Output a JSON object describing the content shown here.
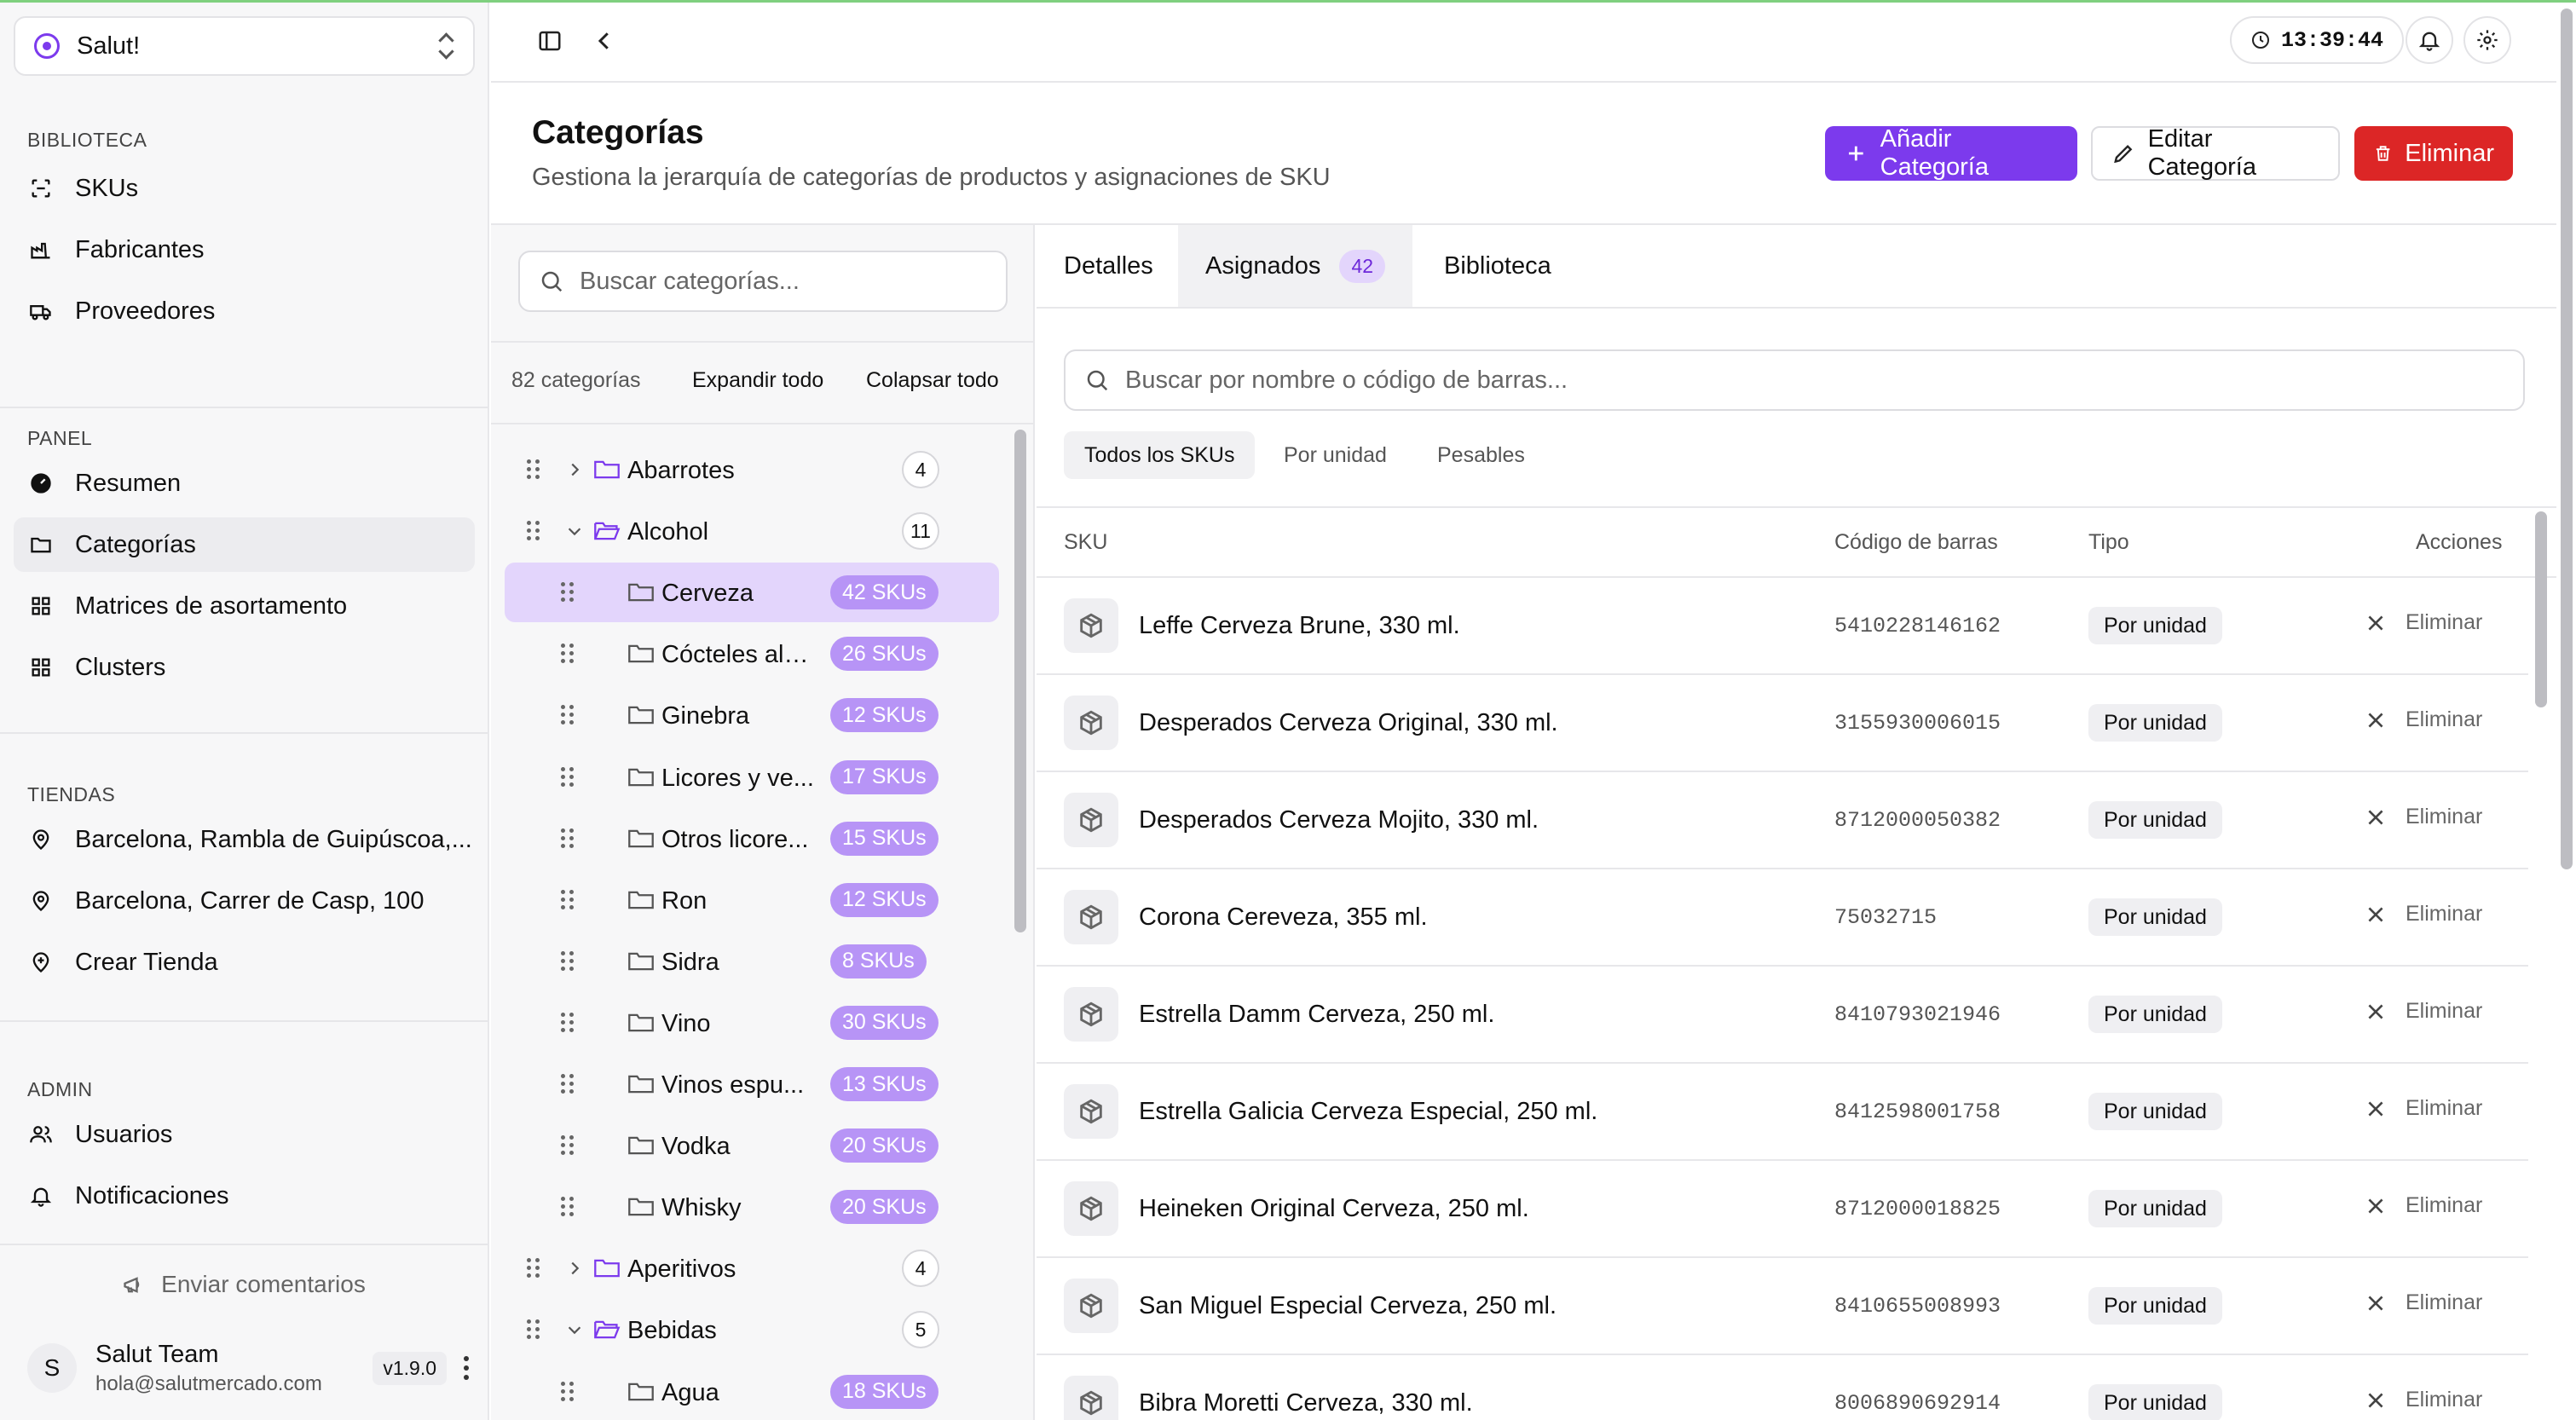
{
  "workspace": {
    "name": "Salut!"
  },
  "sidebar": {
    "sections": [
      {
        "label": "BIBLIOTECA",
        "items": [
          {
            "label": "SKUs",
            "icon": "scan-icon"
          },
          {
            "label": "Fabricantes",
            "icon": "factory-icon"
          },
          {
            "label": "Proveedores",
            "icon": "truck-icon"
          }
        ]
      },
      {
        "label": "PANEL",
        "items": [
          {
            "label": "Resumen",
            "icon": "gauge-icon"
          },
          {
            "label": "Categorías",
            "icon": "folder-icon",
            "active": true
          },
          {
            "label": "Matrices de asortamento",
            "icon": "grid-icon"
          },
          {
            "label": "Clusters",
            "icon": "grid-icon"
          }
        ]
      },
      {
        "label": "TIENDAS",
        "items": [
          {
            "label": "Barcelona, Rambla de Guipúscoa,...",
            "icon": "map-pin-icon"
          },
          {
            "label": "Barcelona, Carrer de Casp, 100",
            "icon": "map-pin-icon"
          },
          {
            "label": "Crear Tienda",
            "icon": "map-pin-plus-icon"
          }
        ]
      },
      {
        "label": "ADMIN",
        "items": [
          {
            "label": "Usuarios",
            "icon": "users-icon"
          },
          {
            "label": "Notificaciones",
            "icon": "bell-icon"
          }
        ]
      }
    ],
    "feedback": "Enviar comentarios",
    "user": {
      "initial": "S",
      "name": "Salut Team",
      "email": "hola@salutmercado.com",
      "version": "v1.9.0"
    }
  },
  "topbar": {
    "clock": "13:39:44"
  },
  "header": {
    "title": "Categorías",
    "subtitle": "Gestiona la jerarquía de categorías de productos y asignaciones de SKU",
    "add_label": "Añadir Categoría",
    "edit_label": "Editar Categoría",
    "delete_label": "Eliminar"
  },
  "categories": {
    "search_placeholder": "Buscar categorías...",
    "count_label": "82 categorías",
    "expand_all": "Expandir todo",
    "collapse_all": "Colapsar todo",
    "tree": [
      {
        "label": "Abarrotes",
        "level": 0,
        "expanded": false,
        "count": "4"
      },
      {
        "label": "Alcohol",
        "level": 0,
        "expanded": true,
        "count": "11"
      },
      {
        "label": "Cerveza",
        "level": 1,
        "count": "42 SKUs",
        "selected": true
      },
      {
        "label": "Cócteles alc...",
        "level": 1,
        "count": "26 SKUs"
      },
      {
        "label": "Ginebra",
        "level": 1,
        "count": "12 SKUs"
      },
      {
        "label": "Licores y ve...",
        "level": 1,
        "count": "17 SKUs"
      },
      {
        "label": "Otros licore...",
        "level": 1,
        "count": "15 SKUs"
      },
      {
        "label": "Ron",
        "level": 1,
        "count": "12 SKUs"
      },
      {
        "label": "Sidra",
        "level": 1,
        "count": "8 SKUs"
      },
      {
        "label": "Vino",
        "level": 1,
        "count": "30 SKUs"
      },
      {
        "label": "Vinos espu...",
        "level": 1,
        "count": "13 SKUs"
      },
      {
        "label": "Vodka",
        "level": 1,
        "count": "20 SKUs"
      },
      {
        "label": "Whisky",
        "level": 1,
        "count": "20 SKUs"
      },
      {
        "label": "Aperitivos",
        "level": 0,
        "expanded": false,
        "count": "4"
      },
      {
        "label": "Bebidas",
        "level": 0,
        "expanded": true,
        "count": "5"
      },
      {
        "label": "Agua",
        "level": 1,
        "count": "18 SKUs"
      }
    ]
  },
  "detail": {
    "tabs": [
      {
        "label": "Detalles"
      },
      {
        "label": "Asignados",
        "count": "42",
        "active": true
      },
      {
        "label": "Biblioteca"
      }
    ],
    "search_placeholder": "Buscar por nombre o código de barras...",
    "filters": [
      "Todos los SKUs",
      "Por unidad",
      "Pesables"
    ],
    "columns": {
      "sku": "SKU",
      "barcode": "Código de barras",
      "type": "Tipo",
      "actions": "Acciones"
    },
    "remove_label": "Eliminar",
    "rows": [
      {
        "name": "Leffe Cerveza Brune, 330 ml.",
        "barcode": "5410228146162",
        "type": "Por unidad"
      },
      {
        "name": "Desperados Cerveza Original, 330 ml.",
        "barcode": "3155930006015",
        "type": "Por unidad"
      },
      {
        "name": "Desperados Cerveza Mojito, 330 ml.",
        "barcode": "8712000050382",
        "type": "Por unidad"
      },
      {
        "name": "Corona Cereveza, 355 ml.",
        "barcode": "75032715",
        "type": "Por unidad"
      },
      {
        "name": "Estrella Damm Cerveza, 250 ml.",
        "barcode": "8410793021946",
        "type": "Por unidad"
      },
      {
        "name": "Estrella Galicia Cerveza Especial, 250 ml.",
        "barcode": "8412598001758",
        "type": "Por unidad"
      },
      {
        "name": "Heineken Original Cerveza, 250 ml.",
        "barcode": "8712000018825",
        "type": "Por unidad"
      },
      {
        "name": "San Miguel Especial Cerveza, 250 ml.",
        "barcode": "8410655008993",
        "type": "Por unidad"
      },
      {
        "name": "Bibra Moretti Cerveza, 330 ml.",
        "barcode": "8006890692914",
        "type": "Por unidad"
      }
    ]
  }
}
